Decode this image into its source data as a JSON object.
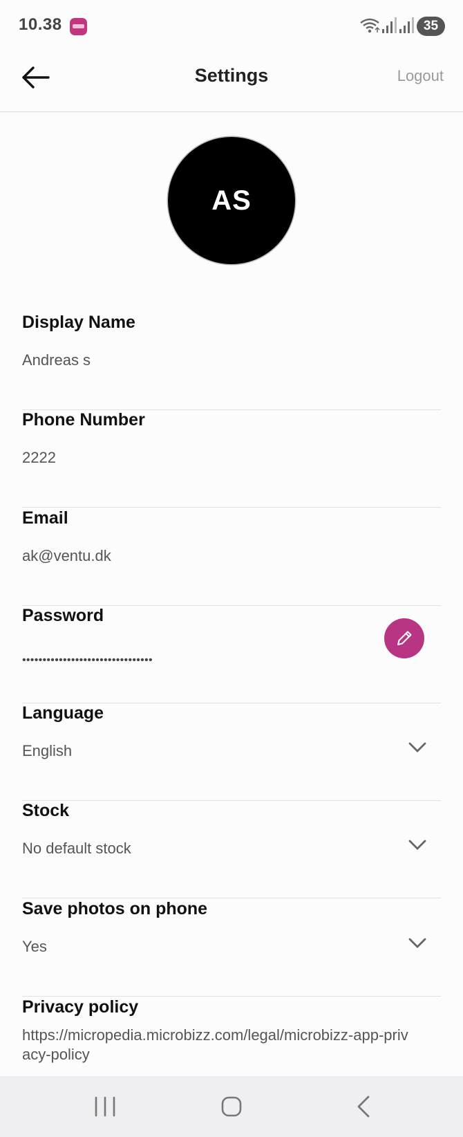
{
  "status_bar": {
    "time": "10.38",
    "battery": "35",
    "icons": [
      "app-icon",
      "wifi-icon",
      "signal-icon",
      "signal-icon",
      "battery-icon"
    ]
  },
  "header": {
    "title": "Settings",
    "logout_label": "Logout",
    "back_icon": "arrow-left-icon"
  },
  "avatar": {
    "initials": "AS"
  },
  "fields": {
    "display_name": {
      "label": "Display Name",
      "value": "Andreas s"
    },
    "phone_number": {
      "label": "Phone Number",
      "value": "2222"
    },
    "email": {
      "label": "Email",
      "value": "ak@ventu.dk"
    },
    "password": {
      "label": "Password",
      "value": "••••••••••••••••••••••••••••••••",
      "edit_icon": "pencil-icon"
    },
    "language": {
      "label": "Language",
      "value": "English"
    },
    "stock": {
      "label": "Stock",
      "value": "No default stock"
    },
    "save_photos": {
      "label": "Save photos on phone",
      "value": "Yes"
    }
  },
  "privacy": {
    "label": "Privacy policy",
    "link": "https://micropedia.microbizz.com/legal/microbizz-app-privacy-policy"
  },
  "nav": {
    "icons": [
      "recent-apps-icon",
      "home-icon",
      "back-icon"
    ]
  },
  "colors": {
    "accent": "#b83583",
    "background": "#fcfcfd",
    "nav_background": "#efeff1"
  }
}
